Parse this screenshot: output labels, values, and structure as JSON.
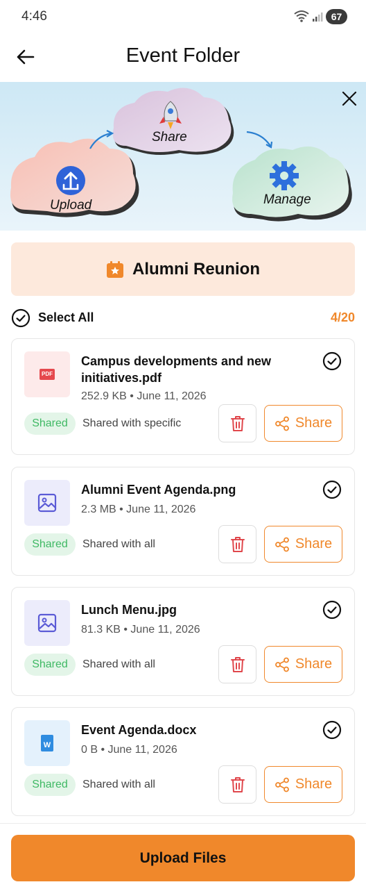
{
  "status_bar": {
    "time": "4:46",
    "battery": "67"
  },
  "header": {
    "title": "Event Folder"
  },
  "banner": {
    "step1": "Upload",
    "step2": "Share",
    "step3": "Manage"
  },
  "event": {
    "title": "Alumni Reunion"
  },
  "selection": {
    "select_all_label": "Select All",
    "count": "4/20"
  },
  "files": [
    {
      "name": "Campus developments and new initiatives.pdf",
      "size": "252.9 KB",
      "date": "June 11, 2026",
      "meta": "252.9 KB • June 11, 2026",
      "status": "Shared",
      "share_info": "Shared with specific",
      "icon": "pdf-icon",
      "icon_label": "PDF",
      "share_label": "Share"
    },
    {
      "name": "Alumni Event Agenda.png",
      "size": "2.3 MB",
      "date": "June 11, 2026",
      "meta": "2.3 MB • June 11, 2026",
      "status": "Shared",
      "share_info": "Shared with all",
      "icon": "image-icon",
      "share_label": "Share"
    },
    {
      "name": "Lunch Menu.jpg",
      "size": "81.3 KB",
      "date": "June 11, 2026",
      "meta": "81.3 KB • June 11, 2026",
      "status": "Shared",
      "share_info": "Shared with all",
      "icon": "image-icon",
      "share_label": "Share"
    },
    {
      "name": "Event Agenda.docx",
      "size": "0 B",
      "date": "June 11, 2026",
      "meta": "0 B • June 11, 2026",
      "status": "Shared",
      "share_info": "Shared with all",
      "icon": "word-doc-icon",
      "icon_label": "W",
      "share_label": "Share"
    }
  ],
  "footer": {
    "upload_label": "Upload Files"
  },
  "colors": {
    "accent": "#f0882b",
    "shared_green": "#3fb964",
    "delete_red": "#e0474c",
    "event_card_bg": "#fde9dc"
  }
}
